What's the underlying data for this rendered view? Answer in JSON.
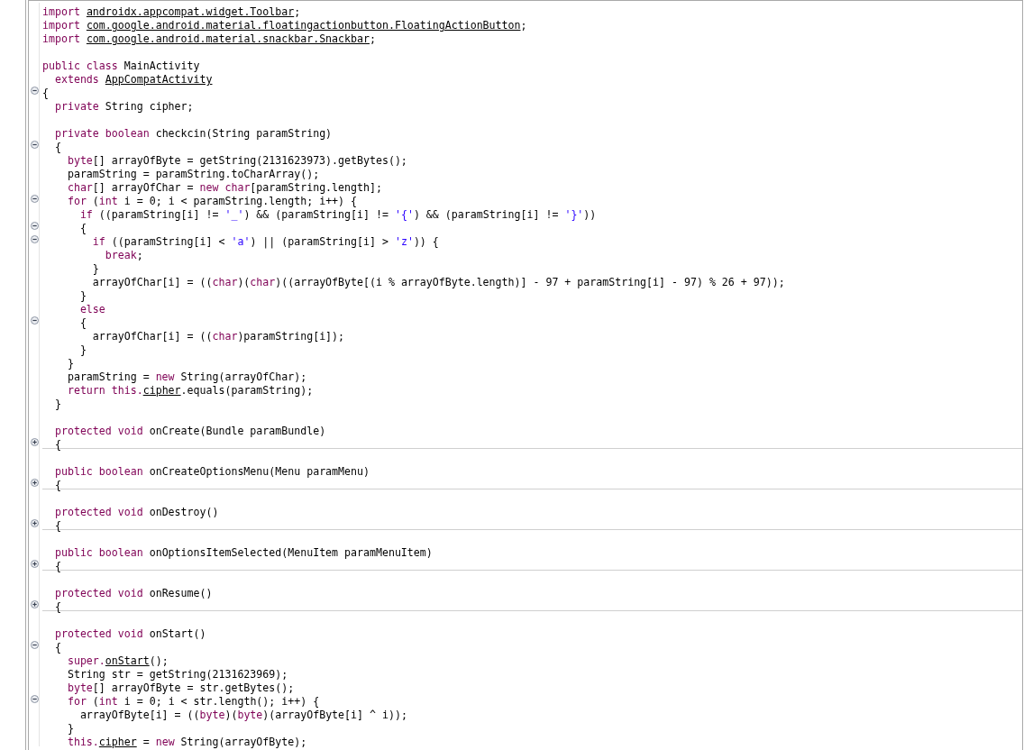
{
  "editor": {
    "lines": [
      {
        "kind": "code",
        "tokens": [
          {
            "kind": "keyword",
            "text": "import "
          },
          {
            "kind": "link",
            "text": "androidx.appcompat.widget.Toolbar"
          },
          {
            "kind": "plain",
            "text": ";"
          }
        ]
      },
      {
        "kind": "code",
        "tokens": [
          {
            "kind": "keyword",
            "text": "import "
          },
          {
            "kind": "link",
            "text": "com.google.android.material.floatingactionbutton.FloatingActionButton"
          },
          {
            "kind": "plain",
            "text": ";"
          }
        ]
      },
      {
        "kind": "code",
        "tokens": [
          {
            "kind": "keyword",
            "text": "import "
          },
          {
            "kind": "link",
            "text": "com.google.android.material.snackbar.Snackbar"
          },
          {
            "kind": "plain",
            "text": ";"
          }
        ]
      },
      {
        "kind": "blank"
      },
      {
        "kind": "code",
        "tokens": [
          {
            "kind": "keyword",
            "text": "public class"
          },
          {
            "kind": "plain",
            "text": " MainActivity"
          }
        ]
      },
      {
        "kind": "code",
        "tokens": [
          {
            "kind": "keyword",
            "text": "  extends "
          },
          {
            "kind": "link",
            "text": "AppCompatActivity"
          }
        ]
      },
      {
        "kind": "code",
        "expanded": true,
        "tokens": [
          {
            "kind": "plain",
            "text": "{"
          }
        ]
      },
      {
        "kind": "code",
        "tokens": [
          {
            "kind": "keyword",
            "text": "  private"
          },
          {
            "kind": "plain",
            "text": " String cipher;"
          }
        ]
      },
      {
        "kind": "blank"
      },
      {
        "kind": "code",
        "tokens": [
          {
            "kind": "keyword",
            "text": "  private boolean"
          },
          {
            "kind": "plain",
            "text": " checkcin(String paramString)"
          }
        ]
      },
      {
        "kind": "code",
        "expanded": true,
        "tokens": [
          {
            "kind": "plain",
            "text": "  {"
          }
        ]
      },
      {
        "kind": "code",
        "tokens": [
          {
            "kind": "keyword",
            "text": "    byte"
          },
          {
            "kind": "plain",
            "text": "[] arrayOfByte = getString(2131623973).getBytes();"
          }
        ]
      },
      {
        "kind": "code",
        "tokens": [
          {
            "kind": "plain",
            "text": "    paramString = paramString.toCharArray();"
          }
        ]
      },
      {
        "kind": "code",
        "tokens": [
          {
            "kind": "keyword",
            "text": "    char"
          },
          {
            "kind": "plain",
            "text": "[] arrayOfChar = "
          },
          {
            "kind": "keyword",
            "text": "new char"
          },
          {
            "kind": "plain",
            "text": "[paramString.length];"
          }
        ]
      },
      {
        "kind": "code",
        "expanded": true,
        "tokens": [
          {
            "kind": "keyword",
            "text": "    for"
          },
          {
            "kind": "plain",
            "text": " ("
          },
          {
            "kind": "keyword",
            "text": "int"
          },
          {
            "kind": "plain",
            "text": " i = 0; i < paramString.length; i++) {"
          }
        ]
      },
      {
        "kind": "code",
        "tokens": [
          {
            "kind": "keyword",
            "text": "      if"
          },
          {
            "kind": "plain",
            "text": " ((paramString[i] != "
          },
          {
            "kind": "string",
            "text": "'_'"
          },
          {
            "kind": "plain",
            "text": ") && (paramString[i] != "
          },
          {
            "kind": "string",
            "text": "'{'"
          },
          {
            "kind": "plain",
            "text": ") && (paramString[i] != "
          },
          {
            "kind": "string",
            "text": "'}'"
          },
          {
            "kind": "plain",
            "text": "))"
          }
        ]
      },
      {
        "kind": "code",
        "expanded": true,
        "tokens": [
          {
            "kind": "plain",
            "text": "      {"
          }
        ]
      },
      {
        "kind": "code",
        "expanded": true,
        "tokens": [
          {
            "kind": "keyword",
            "text": "        if"
          },
          {
            "kind": "plain",
            "text": " ((paramString[i] < "
          },
          {
            "kind": "string",
            "text": "'a'"
          },
          {
            "kind": "plain",
            "text": ") || (paramString[i] > "
          },
          {
            "kind": "string",
            "text": "'z'"
          },
          {
            "kind": "plain",
            "text": ")) {"
          }
        ]
      },
      {
        "kind": "code",
        "tokens": [
          {
            "kind": "keyword",
            "text": "          break"
          },
          {
            "kind": "plain",
            "text": ";"
          }
        ]
      },
      {
        "kind": "code",
        "tokens": [
          {
            "kind": "plain",
            "text": "        }"
          }
        ]
      },
      {
        "kind": "code",
        "tokens": [
          {
            "kind": "plain",
            "text": "        arrayOfChar[i] = (("
          },
          {
            "kind": "keyword",
            "text": "char"
          },
          {
            "kind": "plain",
            "text": ")("
          },
          {
            "kind": "keyword",
            "text": "char"
          },
          {
            "kind": "plain",
            "text": ")((arrayOfByte[(i % arrayOfByte.length)] - 97 + paramString[i] - 97) % 26 + 97));"
          }
        ]
      },
      {
        "kind": "code",
        "tokens": [
          {
            "kind": "plain",
            "text": "      }"
          }
        ]
      },
      {
        "kind": "code",
        "tokens": [
          {
            "kind": "keyword",
            "text": "      else"
          }
        ]
      },
      {
        "kind": "code",
        "expanded": true,
        "tokens": [
          {
            "kind": "plain",
            "text": "      {"
          }
        ]
      },
      {
        "kind": "code",
        "tokens": [
          {
            "kind": "plain",
            "text": "        arrayOfChar[i] = (("
          },
          {
            "kind": "keyword",
            "text": "char"
          },
          {
            "kind": "plain",
            "text": ")paramString[i]);"
          }
        ]
      },
      {
        "kind": "code",
        "tokens": [
          {
            "kind": "plain",
            "text": "      }"
          }
        ]
      },
      {
        "kind": "code",
        "tokens": [
          {
            "kind": "plain",
            "text": "    }"
          }
        ]
      },
      {
        "kind": "code",
        "tokens": [
          {
            "kind": "plain",
            "text": "    paramString = "
          },
          {
            "kind": "keyword",
            "text": "new"
          },
          {
            "kind": "plain",
            "text": " String(arrayOfChar);"
          }
        ]
      },
      {
        "kind": "code",
        "tokens": [
          {
            "kind": "keyword",
            "text": "    return this."
          },
          {
            "kind": "link",
            "text": "cipher"
          },
          {
            "kind": "plain",
            "text": ".equals(paramString);"
          }
        ]
      },
      {
        "kind": "code",
        "tokens": [
          {
            "kind": "plain",
            "text": "  }"
          }
        ]
      },
      {
        "kind": "blank"
      },
      {
        "kind": "code",
        "tokens": [
          {
            "kind": "keyword",
            "text": "  protected void"
          },
          {
            "kind": "plain",
            "text": " onCreate(Bundle paramBundle)"
          }
        ]
      },
      {
        "kind": "code",
        "expanded": false,
        "tokens": [
          {
            "kind": "plain",
            "text": "  {"
          }
        ]
      },
      {
        "kind": "blank"
      },
      {
        "kind": "code",
        "tokens": [
          {
            "kind": "keyword",
            "text": "  public boolean"
          },
          {
            "kind": "plain",
            "text": " onCreateOptionsMenu(Menu paramMenu)"
          }
        ]
      },
      {
        "kind": "code",
        "expanded": false,
        "tokens": [
          {
            "kind": "plain",
            "text": "  {"
          }
        ]
      },
      {
        "kind": "blank"
      },
      {
        "kind": "code",
        "tokens": [
          {
            "kind": "keyword",
            "text": "  protected void"
          },
          {
            "kind": "plain",
            "text": " onDestroy()"
          }
        ]
      },
      {
        "kind": "code",
        "expanded": false,
        "tokens": [
          {
            "kind": "plain",
            "text": "  {"
          }
        ]
      },
      {
        "kind": "blank"
      },
      {
        "kind": "code",
        "tokens": [
          {
            "kind": "keyword",
            "text": "  public boolean"
          },
          {
            "kind": "plain",
            "text": " onOptionsItemSelected(MenuItem paramMenuItem)"
          }
        ]
      },
      {
        "kind": "code",
        "expanded": false,
        "tokens": [
          {
            "kind": "plain",
            "text": "  {"
          }
        ]
      },
      {
        "kind": "blank"
      },
      {
        "kind": "code",
        "tokens": [
          {
            "kind": "keyword",
            "text": "  protected void"
          },
          {
            "kind": "plain",
            "text": " onResume()"
          }
        ]
      },
      {
        "kind": "code",
        "expanded": false,
        "tokens": [
          {
            "kind": "plain",
            "text": "  {"
          }
        ]
      },
      {
        "kind": "blank"
      },
      {
        "kind": "code",
        "tokens": [
          {
            "kind": "keyword",
            "text": "  protected void"
          },
          {
            "kind": "plain",
            "text": " onStart()"
          }
        ]
      },
      {
        "kind": "code",
        "expanded": true,
        "tokens": [
          {
            "kind": "plain",
            "text": "  {"
          }
        ]
      },
      {
        "kind": "code",
        "tokens": [
          {
            "kind": "keyword",
            "text": "    super."
          },
          {
            "kind": "link",
            "text": "onStart"
          },
          {
            "kind": "plain",
            "text": "();"
          }
        ]
      },
      {
        "kind": "code",
        "tokens": [
          {
            "kind": "plain",
            "text": "    String str = getString(2131623969);"
          }
        ]
      },
      {
        "kind": "code",
        "tokens": [
          {
            "kind": "keyword",
            "text": "    byte"
          },
          {
            "kind": "plain",
            "text": "[] arrayOfByte = str.getBytes();"
          }
        ]
      },
      {
        "kind": "code",
        "expanded": true,
        "tokens": [
          {
            "kind": "keyword",
            "text": "    for"
          },
          {
            "kind": "plain",
            "text": " ("
          },
          {
            "kind": "keyword",
            "text": "int"
          },
          {
            "kind": "plain",
            "text": " i = 0; i < str.length(); i++) {"
          }
        ]
      },
      {
        "kind": "code",
        "tokens": [
          {
            "kind": "plain",
            "text": "      arrayOfByte[i] = (("
          },
          {
            "kind": "keyword",
            "text": "byte"
          },
          {
            "kind": "plain",
            "text": ")("
          },
          {
            "kind": "keyword",
            "text": "byte"
          },
          {
            "kind": "plain",
            "text": ")(arrayOfByte[i] ^ i));"
          }
        ]
      },
      {
        "kind": "code",
        "tokens": [
          {
            "kind": "plain",
            "text": "    }"
          }
        ]
      },
      {
        "kind": "code",
        "tokens": [
          {
            "kind": "keyword",
            "text": "    this."
          },
          {
            "kind": "link",
            "text": "cipher"
          },
          {
            "kind": "plain",
            "text": " = "
          },
          {
            "kind": "keyword",
            "text": "new"
          },
          {
            "kind": "plain",
            "text": " String(arrayOfByte);"
          }
        ]
      }
    ]
  }
}
